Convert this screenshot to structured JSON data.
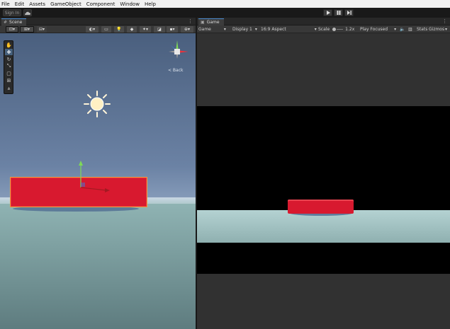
{
  "menu": [
    "File",
    "Edit",
    "Assets",
    "GameObject",
    "Component",
    "Window",
    "Help"
  ],
  "toolbar": {
    "sign_in": "Sign In",
    "play_icon": "play-icon",
    "pause_icon": "pause-icon",
    "step_icon": "step-icon"
  },
  "scene": {
    "tab_label": "Scene",
    "tab_icon": "hash-icon",
    "gizmo_back_label": "< Back",
    "tools": [
      "hand-icon",
      "move-icon",
      "rotate-icon",
      "scale-icon",
      "rect-icon",
      "transform-icon",
      "custom-icon"
    ],
    "active_tool": 1
  },
  "game": {
    "tab_label": "Game",
    "tab_icon": "gamepad-icon",
    "view_dropdown": "Game",
    "display_dropdown": "Display 1",
    "aspect_dropdown": "16:9 Aspect",
    "scale_label": "Scale",
    "scale_value": "1.2x",
    "play_focused": "Play Focused",
    "stats": "Stats",
    "gizmos": "Gizmos"
  },
  "colors": {
    "object_red": "#d8192f",
    "selection_outline": "#f39c3a",
    "y_axis": "#7ed957",
    "x_axis": "#e8333c",
    "z_axis": "#3a7ee0"
  }
}
